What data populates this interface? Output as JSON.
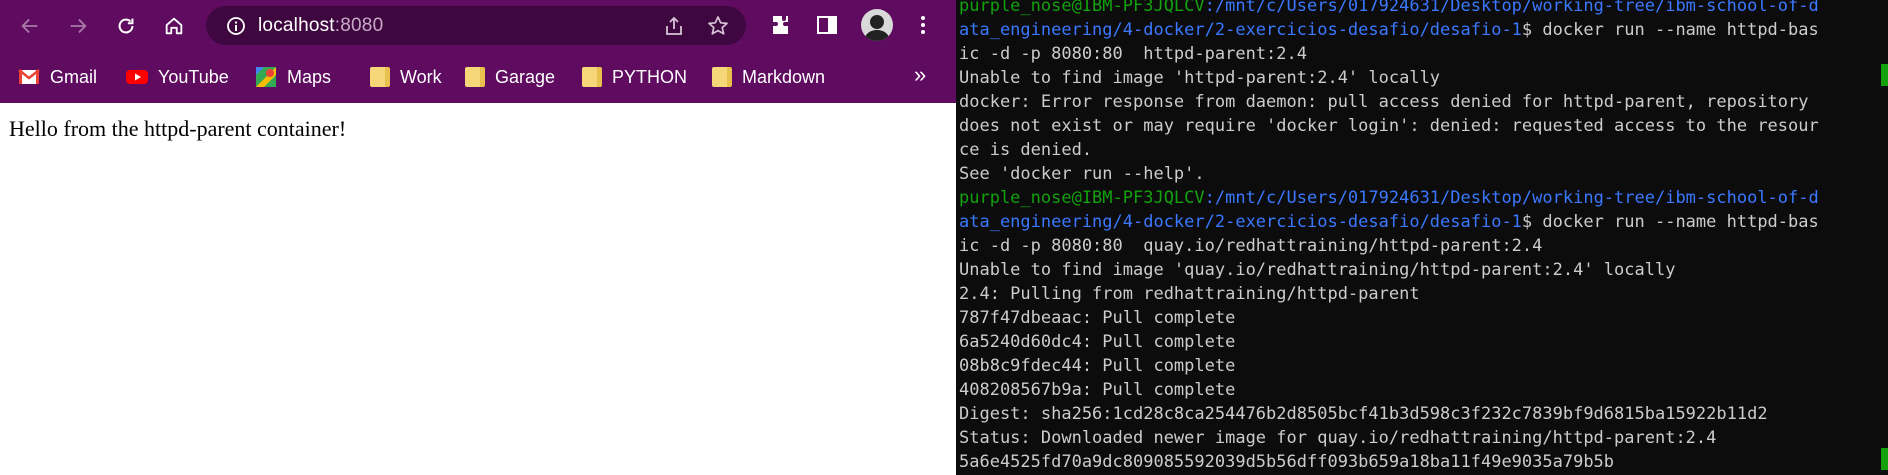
{
  "browser": {
    "url_host": "localhost",
    "url_port": ":8080",
    "bookmarks": [
      "Gmail",
      "YouTube",
      "Maps",
      "Work",
      "Garage",
      "PYTHON",
      "Markdown"
    ],
    "more_label": "»",
    "page_text": "Hello from the httpd-parent container!",
    "colors": {
      "toolbar": "#5f0b60",
      "omnibox": "#3f0740"
    }
  },
  "terminal": {
    "lines": [
      {
        "user": "purple_nose@IBM-PF3JQLCV",
        "path": ":/mnt/c/Users/017924631/Desktop/working-tree/ibm-school-of-d",
        "cmd": ""
      },
      {
        "user": "",
        "path": "ata_engineering/4-docker/2-exercicios-desafio/desafio-1",
        "cmd": "$ docker run --name httpd-bas"
      },
      {
        "user": "",
        "path": "",
        "cmd": "ic -d -p 8080:80  httpd-parent:2.4"
      },
      {
        "user": "",
        "path": "",
        "cmd": "Unable to find image 'httpd-parent:2.4' locally"
      },
      {
        "user": "",
        "path": "",
        "cmd": "docker: Error response from daemon: pull access denied for httpd-parent, repository"
      },
      {
        "user": "",
        "path": "",
        "cmd": "does not exist or may require 'docker login': denied: requested access to the resour"
      },
      {
        "user": "",
        "path": "",
        "cmd": "ce is denied."
      },
      {
        "user": "",
        "path": "",
        "cmd": "See 'docker run --help'."
      },
      {
        "user": "purple_nose@IBM-PF3JQLCV",
        "path": ":/mnt/c/Users/017924631/Desktop/working-tree/ibm-school-of-d",
        "cmd": ""
      },
      {
        "user": "",
        "path": "ata_engineering/4-docker/2-exercicios-desafio/desafio-1",
        "cmd": "$ docker run --name httpd-bas"
      },
      {
        "user": "",
        "path": "",
        "cmd": "ic -d -p 8080:80  quay.io/redhattraining/httpd-parent:2.4"
      },
      {
        "user": "",
        "path": "",
        "cmd": "Unable to find image 'quay.io/redhattraining/httpd-parent:2.4' locally"
      },
      {
        "user": "",
        "path": "",
        "cmd": "2.4: Pulling from redhattraining/httpd-parent"
      },
      {
        "user": "",
        "path": "",
        "cmd": "787f47dbeaac: Pull complete"
      },
      {
        "user": "",
        "path": "",
        "cmd": "6a5240d60dc4: Pull complete"
      },
      {
        "user": "",
        "path": "",
        "cmd": "08b8c9fdec44: Pull complete"
      },
      {
        "user": "",
        "path": "",
        "cmd": "408208567b9a: Pull complete"
      },
      {
        "user": "",
        "path": "",
        "cmd": "Digest: sha256:1cd28c8ca254476b2d8505bcf41b3d598c3f232c7839bf9d6815ba15922b11d2"
      },
      {
        "user": "",
        "path": "",
        "cmd": "Status: Downloaded newer image for quay.io/redhattraining/httpd-parent:2.4"
      },
      {
        "user": "",
        "path": "",
        "cmd": "5a6e4525fd70a9dc809085592039d5b56dff093b659a18ba11f49e9035a79b5b"
      }
    ],
    "colors": {
      "user": "#13a10e",
      "path": "#3b78ff",
      "text": "#cccccc",
      "background": "#0c0c0c"
    }
  }
}
